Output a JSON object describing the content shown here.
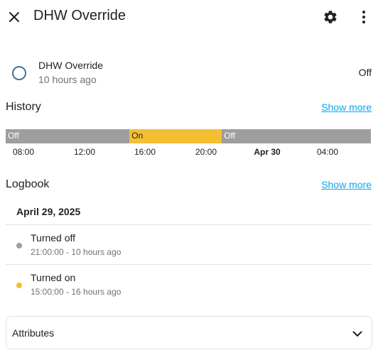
{
  "header": {
    "title": "DHW Override",
    "close_icon": "close-icon",
    "settings_icon": "gear-icon",
    "more_icon": "more-vertical-icon"
  },
  "entity": {
    "name": "DHW Override",
    "last_changed": "10 hours ago",
    "state": "Off",
    "state_color": "#44739e"
  },
  "history": {
    "title": "History",
    "show_more": "Show more",
    "timeline": [
      {
        "state": "Off",
        "fraction": 0.339,
        "color": "#9e9e9e"
      },
      {
        "state": "On",
        "fraction": 0.253,
        "color": "#f4bf33"
      },
      {
        "state": "Off",
        "fraction": 0.408,
        "color": "#9e9e9e"
      }
    ],
    "axis_ticks": [
      {
        "label": "08:00",
        "bold": false
      },
      {
        "label": "12:00",
        "bold": false
      },
      {
        "label": "16:00",
        "bold": false
      },
      {
        "label": "20:00",
        "bold": false
      },
      {
        "label": "Apr 30",
        "bold": true
      },
      {
        "label": "04:00",
        "bold": false
      }
    ]
  },
  "logbook": {
    "title": "Logbook",
    "show_more": "Show more",
    "date": "April 29, 2025",
    "entries": [
      {
        "message": "Turned off",
        "time": "21:00:00 - 10 hours ago",
        "color": "#9e9e9e"
      },
      {
        "message": "Turned on",
        "time": "15:00:00 - 16 hours ago",
        "color": "#f4bf33"
      }
    ]
  },
  "attributes": {
    "label": "Attributes",
    "icon": "chevron-down-icon"
  }
}
